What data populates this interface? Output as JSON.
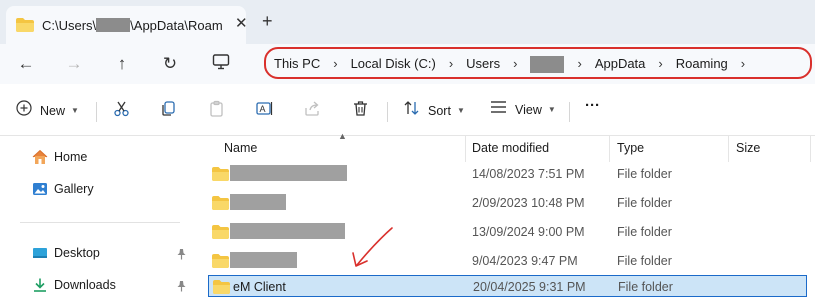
{
  "tab": {
    "title_prefix": "C:\\Users\\",
    "title_suffix": "\\AppData\\Roam",
    "close": "✕",
    "new_tab": "+"
  },
  "nav": {
    "back": "←",
    "forward": "→",
    "up": "↑",
    "refresh": "↻"
  },
  "breadcrumb": {
    "items": [
      "This PC",
      "Local Disk (C:)",
      "Users",
      "",
      "AppData",
      "Roaming"
    ],
    "separator": "›"
  },
  "commands": {
    "new": "New",
    "sort": "Sort",
    "view": "View",
    "more": "···"
  },
  "sidebar": {
    "items": [
      {
        "label": "Home",
        "icon": "home-icon"
      },
      {
        "label": "Gallery",
        "icon": "gallery-icon"
      },
      {
        "label": "Desktop",
        "icon": "desktop-icon",
        "pinned": true
      },
      {
        "label": "Downloads",
        "icon": "downloads-icon",
        "pinned": true
      }
    ]
  },
  "columns": {
    "name": "Name",
    "date_modified": "Date modified",
    "type": "Type",
    "size": "Size"
  },
  "rows": [
    {
      "name": "",
      "redacted": true,
      "date": "14/08/2023 7:51 PM",
      "type": "File folder",
      "selected": false
    },
    {
      "name": "",
      "redacted": true,
      "date": "2/09/2023 10:48 PM",
      "type": "File folder",
      "selected": false
    },
    {
      "name": "",
      "redacted": true,
      "date": "13/09/2024 9:00 PM",
      "type": "File folder",
      "selected": false
    },
    {
      "name": "",
      "redacted": true,
      "date": "9/04/2023 9:47 PM",
      "type": "File folder",
      "selected": false
    },
    {
      "name": "eM Client",
      "redacted": false,
      "date": "20/04/2025 9:31 PM",
      "type": "File folder",
      "selected": true
    }
  ],
  "colors": {
    "highlight_outline": "#d9302c",
    "selection_bg": "#cce4f7",
    "selection_border": "#1b6ac9",
    "folder": "#f4c542"
  }
}
